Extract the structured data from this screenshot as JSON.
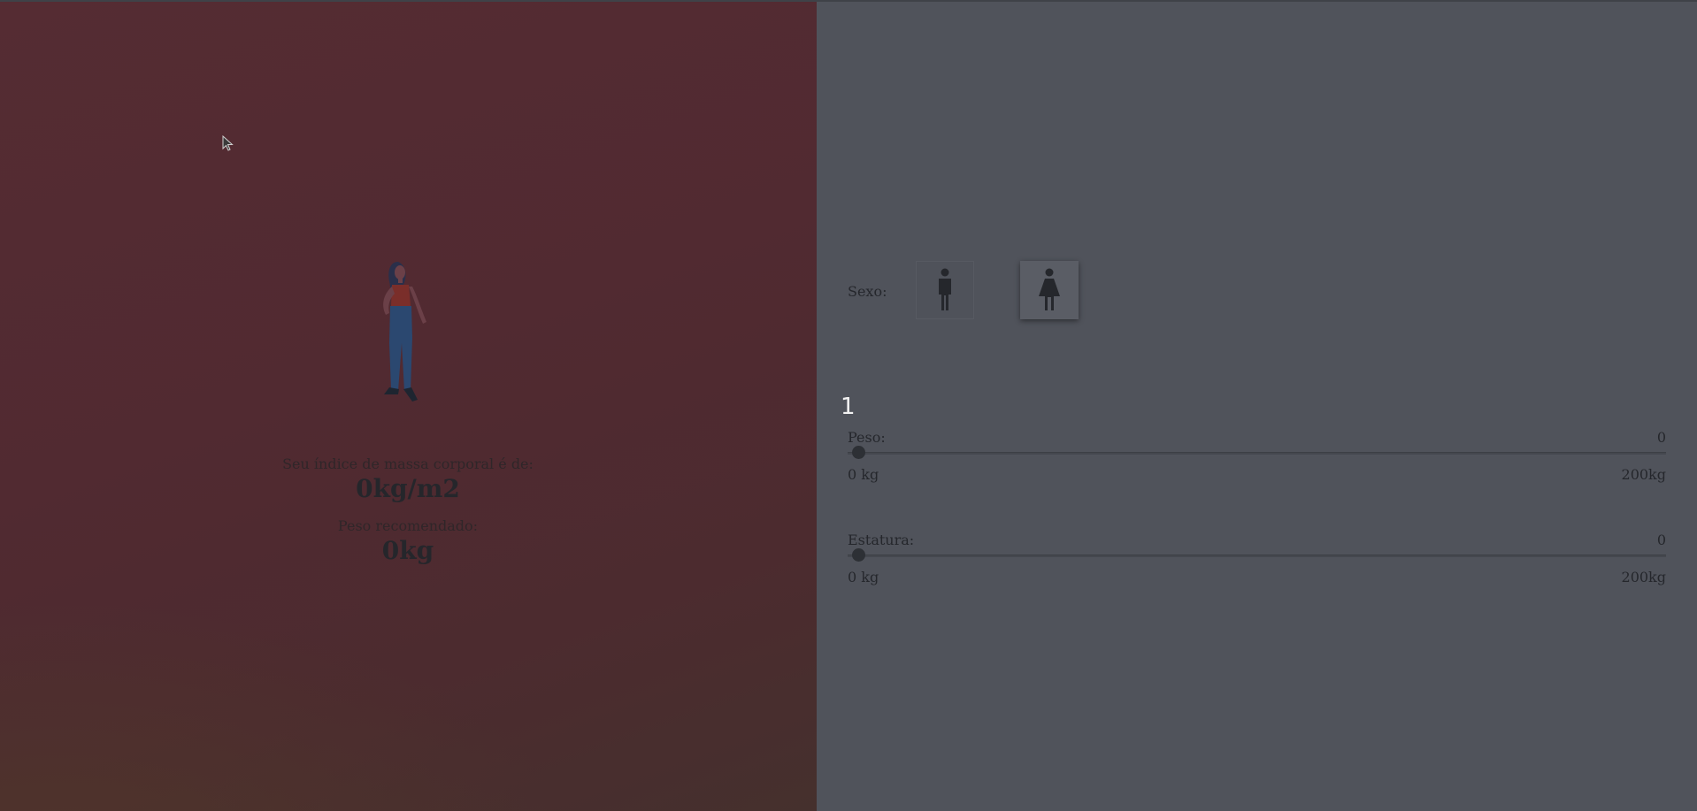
{
  "left": {
    "bmi_label": "Seu índice de massa corporal é de:",
    "bmi_value": "0kg/m2",
    "recommended_label": "Peso recomendado:",
    "recommended_value": "0kg"
  },
  "right": {
    "sex_label": "Sexo:",
    "sex_options": [
      {
        "icon": "male-icon",
        "selected": false
      },
      {
        "icon": "female-icon",
        "selected": true
      }
    ],
    "step_number": "1",
    "peso": {
      "label": "Peso:",
      "value": "0",
      "min_label": "0 kg",
      "max_label": "200kg",
      "slider_fraction": 0
    },
    "estatura": {
      "label": "Estatura:",
      "value": "0",
      "min_label": "0 kg",
      "max_label": "200kg",
      "slider_fraction": 0
    }
  },
  "colors": {
    "left_panel": "#532b32",
    "right_panel": "#50535b",
    "text_dark": "#25272c",
    "step_number": "#f2f2f2"
  }
}
